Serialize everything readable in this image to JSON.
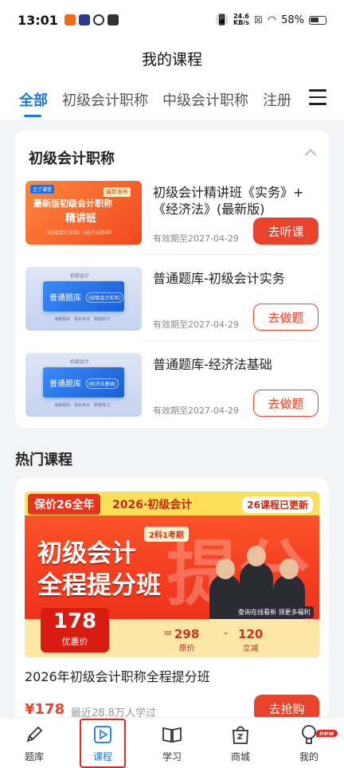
{
  "status": {
    "time": "13:01",
    "speed_value": "24.6",
    "speed_unit": "KB/s",
    "battery": "58%"
  },
  "header": {
    "title": "我的课程",
    "tabs": [
      "全部",
      "初级会计职称",
      "中级会计职称",
      "注册"
    ]
  },
  "my_courses": {
    "section_title": "初级会计职称",
    "items": [
      {
        "name": "初级会计精讲班《实务》+《经济法》(最新版)",
        "expire": "有效期至2027-04-29",
        "action": "去听课",
        "thumb": {
          "brand": "之了课堂",
          "tag": "最新发布",
          "line1": "最新版初级会计职称",
          "line2": "精讲班",
          "line3": "《初级会计实务》《经济法基础》"
        }
      },
      {
        "name": "普通题库-初级会计实务",
        "expire": "有效期至2027-04-29",
        "action": "去做题",
        "thumb": {
          "top": "初级会计",
          "title": "普通题库",
          "pill": "(初级会计实务)",
          "foot": "海量题库　强化考点　刷题练习"
        }
      },
      {
        "name": "普通题库-经济法基础",
        "expire": "有效期至2027-04-29",
        "action": "去做题",
        "thumb": {
          "top": "初级会计",
          "title": "普通题库",
          "pill": "(经济法基础)",
          "foot": "海量题库　强化考点　刷题练习"
        }
      }
    ]
  },
  "hot": {
    "section_title": "热门课程",
    "banner": {
      "price_tag": "保价26全年",
      "year_tag": "2026·初级会计",
      "update": "26课程已更新",
      "subjects": "2科1考期",
      "title_line1": "初级会计",
      "title_line2": "全程提分班",
      "big_char": "提分",
      "price": "178",
      "price_label": "优惠价",
      "eq": "=",
      "original": "298",
      "original_label": "原价",
      "minus": "-",
      "save": "120",
      "save_label": "立减",
      "live": "查询在线看新 领更多福利"
    },
    "course_name": "2026年初级会计职称全程提分班",
    "price": "¥178",
    "students": "最近28.8万人学过",
    "action": "去抢购"
  },
  "tabbar": {
    "items": [
      "题库",
      "课程",
      "学习",
      "商城",
      "我的"
    ],
    "badge": "new"
  },
  "colors": {
    "accent_blue": "#1677e8",
    "accent_red": "#e8432c"
  }
}
